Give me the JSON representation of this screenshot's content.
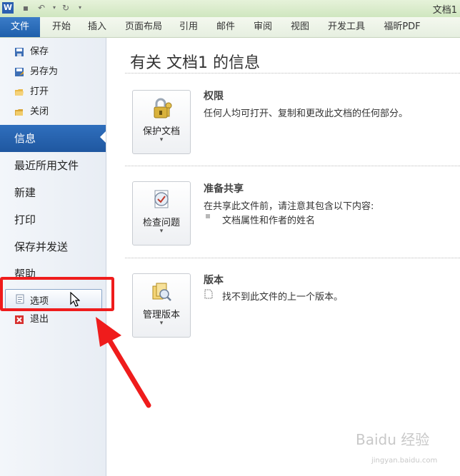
{
  "window": {
    "title": "文档1"
  },
  "ribbon": {
    "tabs": [
      {
        "label": "文件"
      },
      {
        "label": "开始"
      },
      {
        "label": "插入"
      },
      {
        "label": "页面布局"
      },
      {
        "label": "引用"
      },
      {
        "label": "邮件"
      },
      {
        "label": "审阅"
      },
      {
        "label": "视图"
      },
      {
        "label": "开发工具"
      },
      {
        "label": "福昕PDF"
      }
    ]
  },
  "nav": {
    "save": "保存",
    "save_as": "另存为",
    "open": "打开",
    "close": "关闭",
    "info": "信息",
    "recent": "最近所用文件",
    "new": "新建",
    "print": "打印",
    "save_send": "保存并发送",
    "help": "帮助",
    "options": "选项",
    "exit": "退出"
  },
  "main": {
    "title": "有关 文档1 的信息",
    "sections": [
      {
        "button": "保护文档",
        "heading": "权限",
        "desc": "任何人均可打开、复制和更改此文档的任何部分。"
      },
      {
        "button": "检查问题",
        "heading": "准备共享",
        "desc": "在共享此文件前，请注意其包含以下内容:",
        "bullet": "文档属性和作者的姓名"
      },
      {
        "button": "管理版本",
        "heading": "版本",
        "desc": "找不到此文件的上一个版本。"
      }
    ]
  },
  "watermark": {
    "text": "Baidu 经验",
    "url": "jingyan.baidu.com"
  },
  "colors": {
    "accent": "#1f5fab",
    "highlight": "#ef1c1c"
  }
}
